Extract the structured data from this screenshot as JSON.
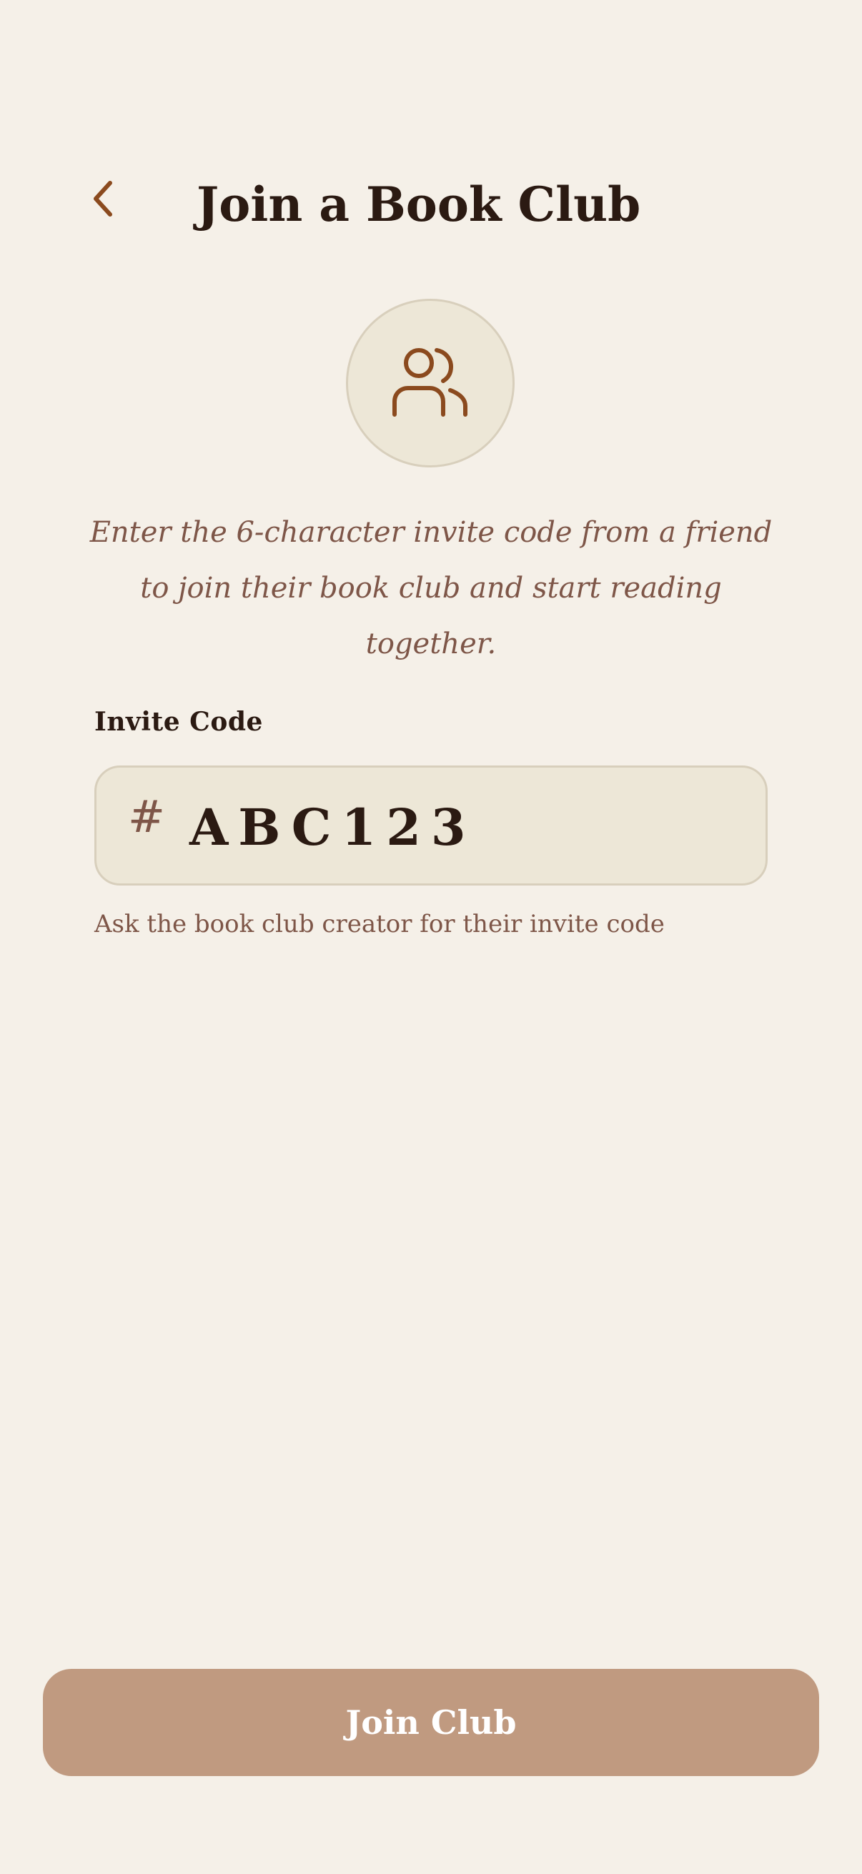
{
  "header": {
    "back_icon": "chevron-left-icon",
    "title": "Join a Book Club"
  },
  "hero": {
    "icon": "users-icon"
  },
  "intro": {
    "text": "Enter the 6-character invite code from a friend to join their book club and start reading together."
  },
  "invite_code": {
    "label": "Invite Code",
    "prefix_symbol": "#",
    "value": "ABC123",
    "helper": "Ask the book club creator for their invite code"
  },
  "footer": {
    "join_label": "Join Club"
  },
  "colors": {
    "background": "#F5F0E8",
    "accent": "#8B4A1E",
    "title_text": "#2B1A12",
    "muted_text": "#7E5648",
    "field_fill": "#EDE7D7",
    "field_border": "#D8CFBC",
    "button_fill": "#C09A80",
    "button_text": "#FFFFFF"
  }
}
